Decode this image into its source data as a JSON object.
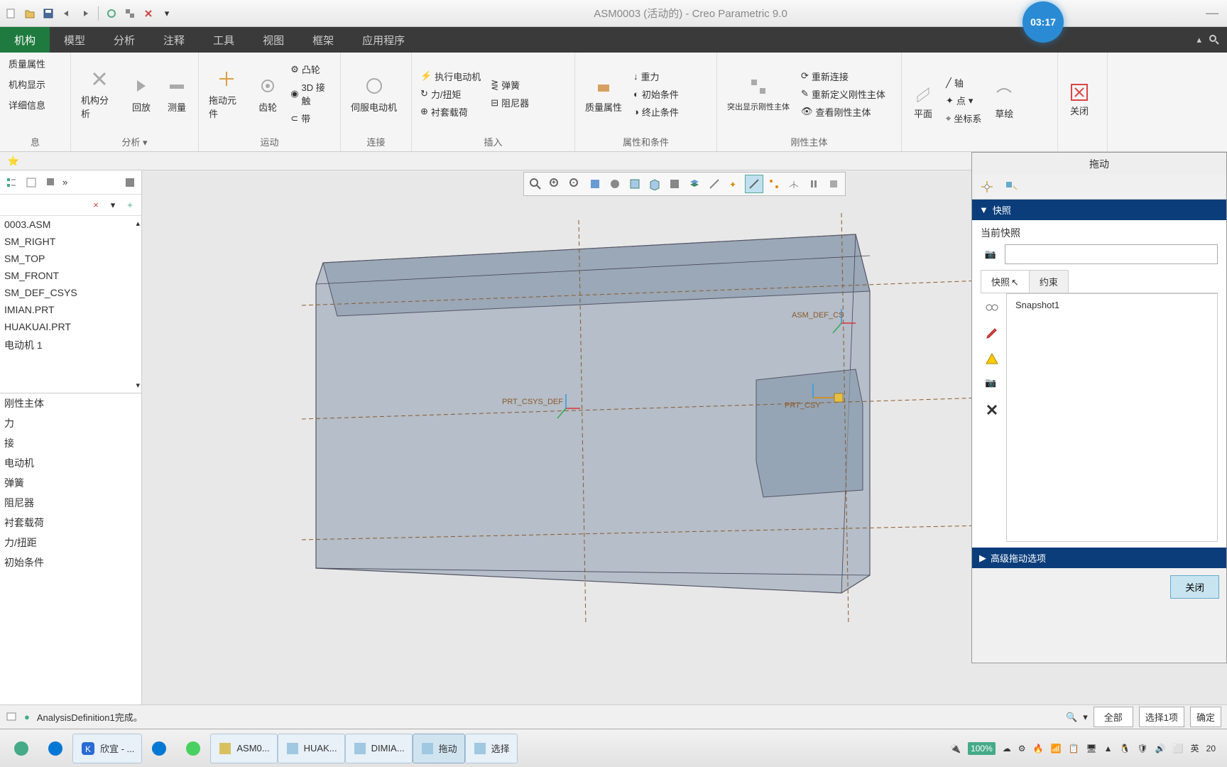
{
  "title": "ASM0003 (活动的) - Creo Parametric 9.0",
  "time_badge": "03:17",
  "tabs": [
    "机构",
    "模型",
    "分析",
    "注释",
    "工具",
    "视图",
    "框架",
    "应用程序"
  ],
  "active_tab": 0,
  "ribbon": {
    "g0_items": [
      "质量属性",
      "机构显示",
      "详细信息"
    ],
    "g0_label": "息",
    "g1_a": "机构分析",
    "g1_b": "回放",
    "g1_c": "测量",
    "g1_label": "分析",
    "g2_a": "拖动元件",
    "g2_b": "齿轮",
    "g2_cam": "凸轮",
    "g2_3d": "3D 接触",
    "g2_belt": "带",
    "g2_label": "运动",
    "g3_a": "伺服电动机",
    "g3_items": [
      "执行电动机",
      "力/扭矩",
      "衬套载荷"
    ],
    "g3_items2": [
      "弹簧",
      "阻尼器"
    ],
    "g3_label": "连接",
    "g4_a": "质量属性",
    "g4_items": [
      "重力",
      "初始条件",
      "终止条件"
    ],
    "g4_label": "插入",
    "g5_a": "突出显示刚性主体",
    "g5_items": [
      "重新连接",
      "重新定义刚性主体",
      "查看刚性主体"
    ],
    "g5_label": "属性和条件",
    "g5b_label": "刚性主体",
    "g6_a": "平面",
    "g6_items": [
      "轴",
      "点",
      "坐标系"
    ],
    "g6_b": "草绘",
    "g7_a": "关闭"
  },
  "tree_upper": [
    "0003.ASM",
    "SM_RIGHT",
    "SM_TOP",
    "SM_FRONT",
    "SM_DEF_CSYS",
    "IMIAN.PRT",
    "HUAKUAI.PRT",
    "电动机 1"
  ],
  "tree_lower": [
    "刚性主体",
    "力",
    "接",
    "电动机",
    "弹簧",
    "阻尼器",
    "衬套载荷",
    "力/扭距",
    "初始条件"
  ],
  "viewport_labels": {
    "csys1": "ASM_DEF_CS",
    "csys2": "PRT_CSYS_DEF",
    "csys3": "PRT_CSY"
  },
  "rpanel": {
    "title": "拖动",
    "section": "快照",
    "current_label": "当前快照",
    "current_value": "",
    "tabs": [
      "快照",
      "约束"
    ],
    "items": [
      "Snapshot1"
    ],
    "adv": "高级拖动选项",
    "close": "关闭"
  },
  "status": {
    "msg": "AnalysisDefinition1完成。",
    "filter": "全部",
    "sel_prompt": "选择1项",
    "ok": "确定"
  },
  "taskbar": {
    "items": [
      "欣宜 - ...",
      "ASM0...",
      "HUAK...",
      "DIMIA...",
      "拖动",
      "选择"
    ],
    "battery": "100%",
    "ime": "英",
    "year": "20"
  }
}
